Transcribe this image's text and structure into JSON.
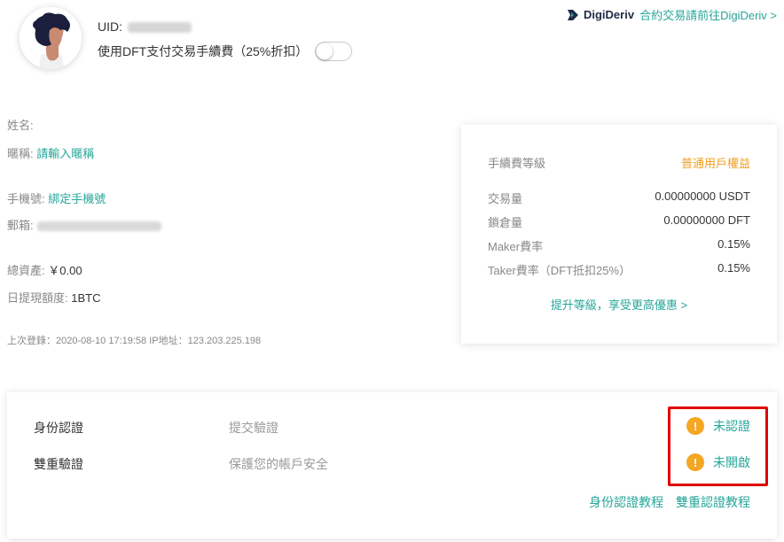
{
  "profile": {
    "uid_label": "UID:",
    "dft_fee_label": "使用DFT支付交易手續費（25%折扣）",
    "dft_fee_enabled": false
  },
  "brand": {
    "name": "DigiDeriv",
    "link_text": "合約交易請前往DigiDeriv >",
    "colors": {
      "accent": "#26a69a",
      "warning": "#f5a623",
      "brand_dark": "#1f2a44",
      "highlight": "#e00000"
    }
  },
  "info": {
    "name_label": "姓名:",
    "nickname_label": "暱稱:",
    "nickname_link": "請輸入暱稱",
    "phone_label": "手機號:",
    "phone_link": "綁定手機號",
    "email_label": "郵箱:",
    "assets_label": "總資產:",
    "assets_value": "￥0.00",
    "withdraw_label": "日提現額度:",
    "withdraw_value": "1BTC",
    "last_login": "上次登錄：2020-08-10 17:19:58 IP地址：123.203.225.198"
  },
  "fee_card": {
    "level_label": "手續費等級",
    "level_value": "普通用戶權益",
    "rows": [
      {
        "label": "交易量",
        "value": "0.00000000 USDT"
      },
      {
        "label": "鎖倉量",
        "value": "0.00000000 DFT"
      },
      {
        "label": "Maker費率",
        "value": "0.15%"
      },
      {
        "label": "Taker費率（DFT抵扣25%）",
        "value": "0.15%"
      }
    ],
    "upgrade_link": "提升等級，享受更高優惠 >"
  },
  "verification": {
    "identity": {
      "title": "身份認證",
      "desc": "提交驗證",
      "status": "未認證"
    },
    "two_factor": {
      "title": "雙重驗證",
      "desc": "保護您的帳戶安全",
      "status": "未開啟"
    },
    "tutorial_identity": "身份認證教程",
    "tutorial_2fa": "雙重認證教程"
  }
}
